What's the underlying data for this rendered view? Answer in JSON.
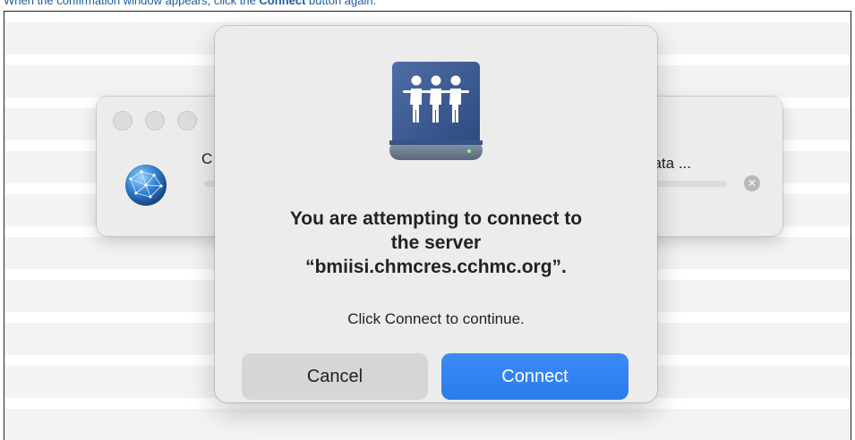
{
  "instruction": {
    "before": "When the confirmation window appears, click the ",
    "bold": "Connect",
    "after": " button again."
  },
  "progress_window": {
    "label_left": "C",
    "label_right": "data ...",
    "cancel_icon": "x-circle-icon"
  },
  "dialog": {
    "icon": "shared-server-icon",
    "title_lines": [
      "You are attempting to connect to",
      "the server",
      "“bmiisi.chmcres.cchmc.org”."
    ],
    "message": "Click Connect to continue.",
    "cancel_label": "Cancel",
    "connect_label": "Connect"
  },
  "colors": {
    "accent": "#2f82f0",
    "instruction_text": "#1a5b9c"
  }
}
